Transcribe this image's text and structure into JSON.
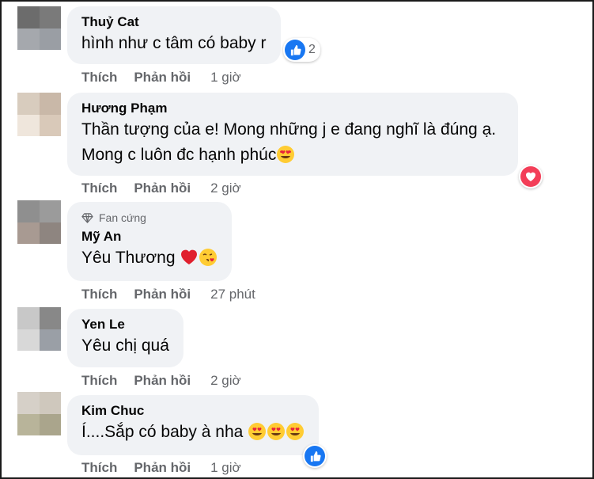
{
  "actions": {
    "like": "Thích",
    "reply": "Phản hồi"
  },
  "comments": [
    {
      "author": "Thuỷ Cat",
      "text": "hình như c tâm có baby r",
      "time": "1 giờ",
      "reaction": {
        "type": "like-icon",
        "count": "2"
      },
      "avatar_colors": [
        "#6c6c6c",
        "#7a7a7a",
        "#a5a8ad",
        "#9a9ea4"
      ]
    },
    {
      "author": "Hương Phạm",
      "line1": "Thần tượng của e! Mong những j e đang nghĩ là đúng ạ.",
      "line2": "Mong c luôn đc hạnh phúc",
      "time": "2 giờ",
      "reaction": {
        "type": "heart-icon"
      },
      "avatar_colors": [
        "#d8ccbe",
        "#c9b8a8",
        "#efe6dc",
        "#d9c9b9"
      ]
    },
    {
      "badge": "Fan cứng",
      "author": "Mỹ An",
      "text": "Yêu Thương",
      "time": "27 phút",
      "avatar_colors": [
        "#8f8f8f",
        "#9b9b9b",
        "#a89a92",
        "#8e8580"
      ]
    },
    {
      "author": "Yen Le",
      "text": "Yêu chị quá",
      "time": "2 giờ",
      "avatar_colors": [
        "#c8c8c8",
        "#888888",
        "#d8d8d8",
        "#9a9fa6"
      ]
    },
    {
      "author": "Kim Chuc",
      "text": "Í....Sắp có baby à nha",
      "time": "1 giờ",
      "reaction": {
        "type": "like-icon"
      },
      "avatar_colors": [
        "#d6d0c8",
        "#cfc8bd",
        "#b8b49a",
        "#aaa58c"
      ]
    }
  ],
  "colors": {
    "bubble": "#f0f2f5",
    "meta": "#65676b",
    "like": "#1877f2",
    "love": "#f33e58"
  }
}
